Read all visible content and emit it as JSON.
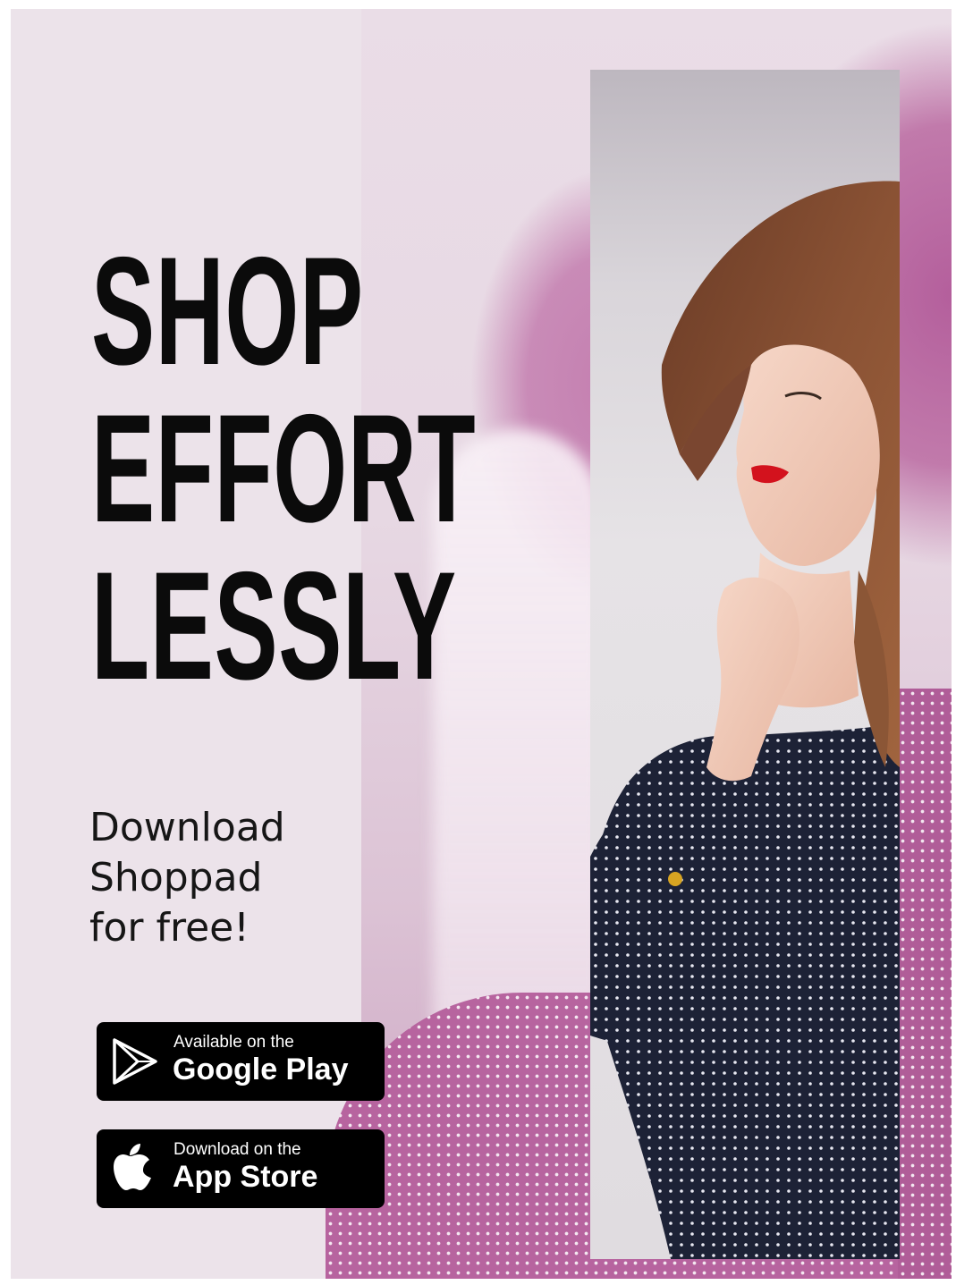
{
  "headline": {
    "line1": "SHOP",
    "line2": "EFFORT",
    "line3": "LESSLY"
  },
  "subtext": {
    "line1": "Download",
    "line2": "Shoppad",
    "line3": "for free!"
  },
  "google_badge": {
    "small": "Available on the",
    "big": "Google Play",
    "icon": "google-play-icon"
  },
  "apple_badge": {
    "small": "Download on the",
    "big": "App Store",
    "icon": "apple-icon"
  },
  "colors": {
    "background": "#ece3ea",
    "accent": "#b7649f",
    "text": "#0b0b0b",
    "badge": "#000000"
  }
}
